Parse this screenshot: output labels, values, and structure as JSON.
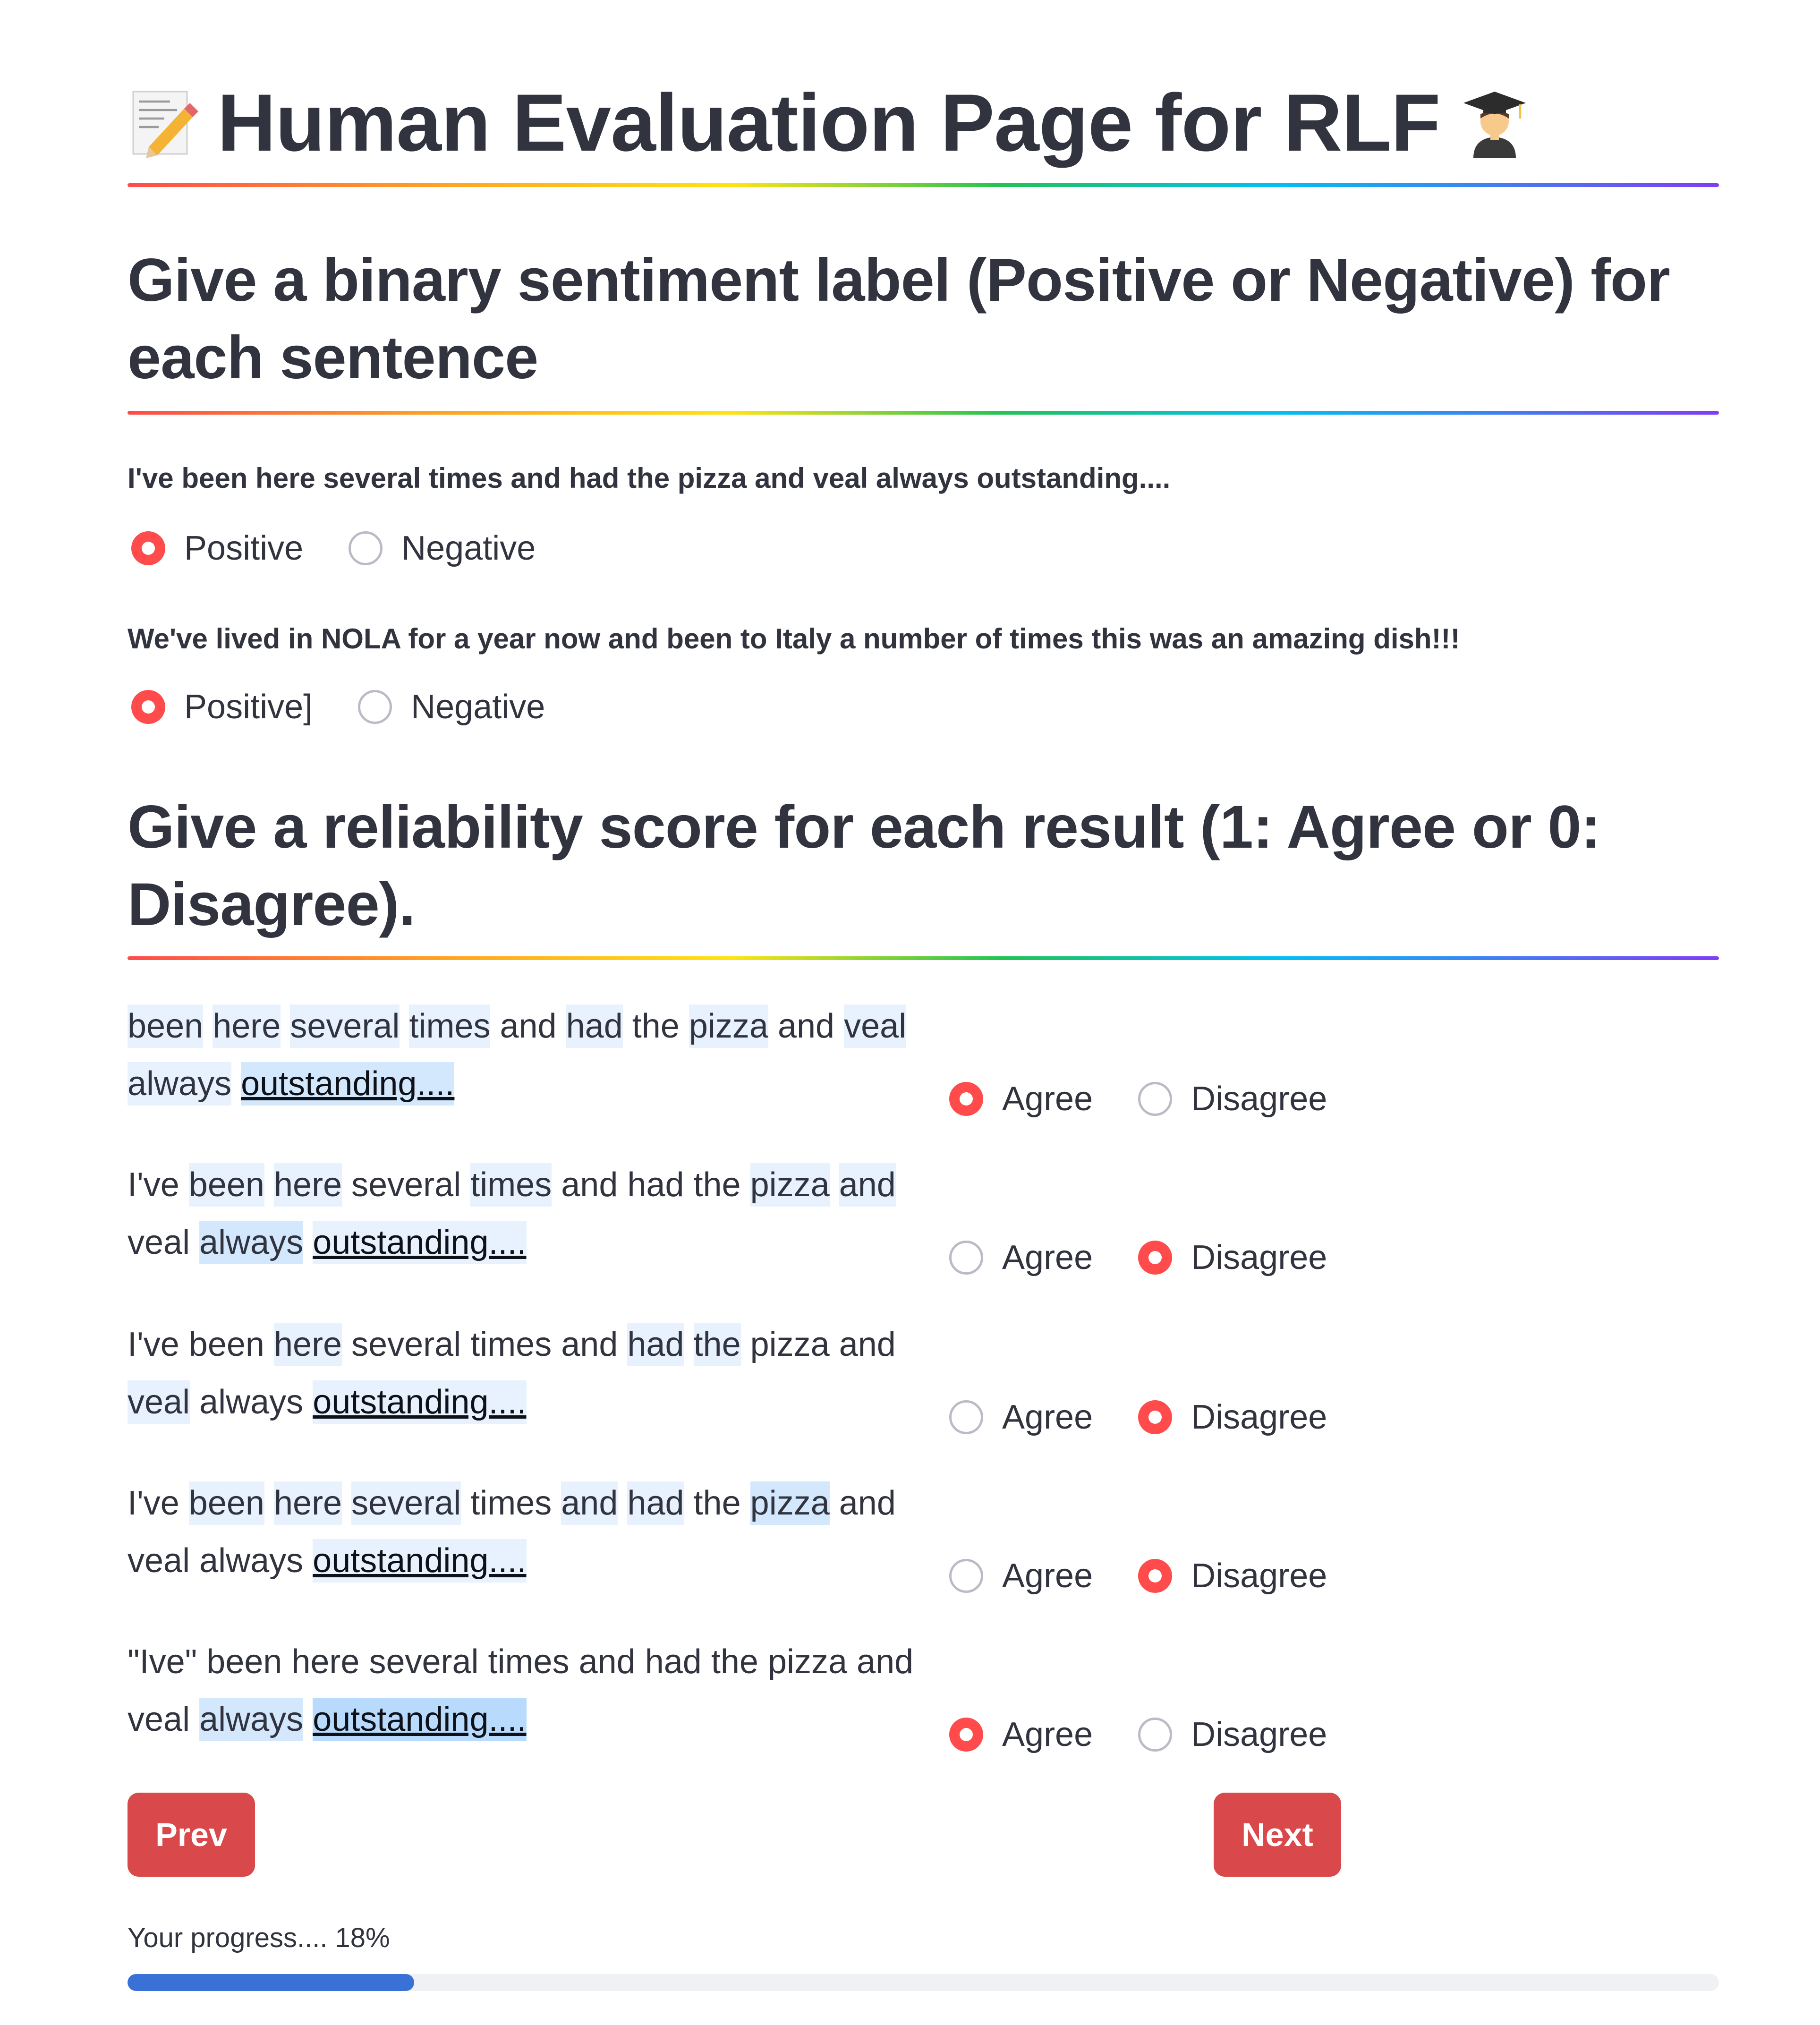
{
  "header": {
    "title": "Human Evaluation Page for RLF",
    "left_icon": "memo-icon",
    "right_icon": "student-icon"
  },
  "section1": {
    "heading": "Give a binary sentiment label (Positive or Negative) for each sentence",
    "questions": [
      {
        "text": "I've been here several times and had the pizza and veal always outstanding....",
        "options": [
          "Positive",
          "Negative"
        ],
        "selected": 0
      },
      {
        "text": "We've lived in NOLA for a year now and been to Italy a number of times this was an amazing dish!!!",
        "options": [
          "Positive]",
          "Negative"
        ],
        "selected": 0
      }
    ]
  },
  "section2": {
    "heading": "Give a reliability score for each result (1: Agree or 0: Disagree).",
    "options": [
      "Agree",
      "Disagree"
    ],
    "items": [
      {
        "line1": "been here several times and had the pizza and veal",
        "line2": "always outstanding....",
        "selected": "Agree"
      },
      {
        "line1": "I've been here several times and had the pizza and",
        "line2": "veal always outstanding....",
        "selected": "Disagree"
      },
      {
        "line1": "I've been here several times and had the pizza and",
        "line2": "veal always outstanding....",
        "selected": "Disagree"
      },
      {
        "line1": "I've been here several times and had the pizza and",
        "line2": "veal always outstanding....",
        "selected": "Disagree"
      },
      {
        "line1": "\"Ive\" been here several times and had the pizza and",
        "line2": "veal always outstanding....",
        "selected": "Agree"
      }
    ]
  },
  "nav": {
    "prev_label": "Prev",
    "next_label": "Next"
  },
  "progress": {
    "label": "Your progress.... 18%",
    "value": 0.18
  },
  "colors": {
    "accent": "#ff4b4b",
    "button": "#d9484a",
    "progress": "#3a71d6",
    "highlight": "#d4e8fd"
  }
}
